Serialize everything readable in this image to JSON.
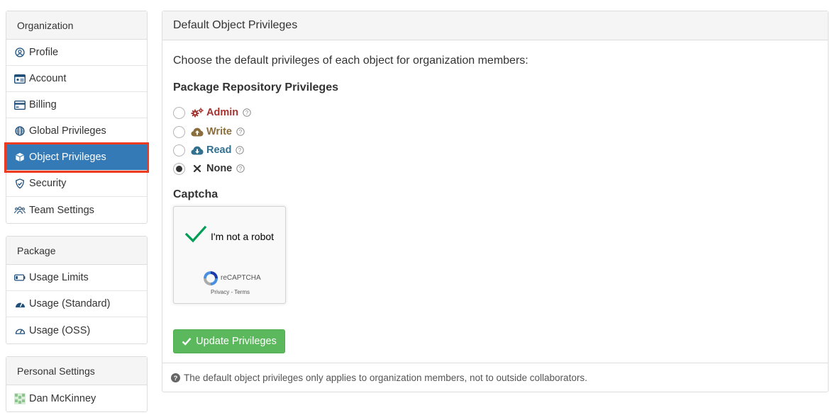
{
  "sidebar": {
    "organization": {
      "title": "Organization",
      "items": [
        {
          "label": "Profile",
          "icon": "user-circle-icon"
        },
        {
          "label": "Account",
          "icon": "id-card-icon"
        },
        {
          "label": "Billing",
          "icon": "credit-card-icon"
        },
        {
          "label": "Global Privileges",
          "icon": "globe-icon"
        },
        {
          "label": "Object Privileges",
          "icon": "cube-icon",
          "active": true
        },
        {
          "label": "Security",
          "icon": "shield-icon"
        },
        {
          "label": "Team Settings",
          "icon": "users-icon"
        }
      ]
    },
    "package": {
      "title": "Package",
      "items": [
        {
          "label": "Usage Limits",
          "icon": "battery-icon"
        },
        {
          "label": "Usage (Standard)",
          "icon": "gauge-icon"
        },
        {
          "label": "Usage (OSS)",
          "icon": "gauge-outline-icon"
        }
      ]
    },
    "personal": {
      "title": "Personal Settings",
      "items": [
        {
          "label": "Dan McKinney",
          "icon": "avatar-icon"
        }
      ]
    }
  },
  "panel": {
    "title": "Default Object Privileges",
    "lead": "Choose the default privileges of each object for organization members:",
    "privileges_heading": "Package Repository Privileges",
    "options": [
      {
        "label": "Admin",
        "icon": "cogs-icon",
        "color": "#a4332f",
        "checked": false
      },
      {
        "label": "Write",
        "icon": "cloud-upload-icon",
        "color": "#8a6d3b",
        "checked": false
      },
      {
        "label": "Read",
        "icon": "cloud-download-icon",
        "color": "#31708f",
        "checked": false
      },
      {
        "label": "None",
        "icon": "times-icon",
        "color": "#333333",
        "checked": true
      }
    ],
    "captcha_heading": "Captcha",
    "captcha": {
      "label": "I'm not a robot",
      "brand": "reCAPTCHA",
      "links": "Privacy - Terms"
    },
    "button": "Update Privileges",
    "footer_note": "The default object privileges only applies to organization members, not to outside collaborators."
  },
  "colors": {
    "active_bg": "#337ab7",
    "highlight_outline": "#ee3b1f",
    "button_green": "#5cb85c"
  }
}
